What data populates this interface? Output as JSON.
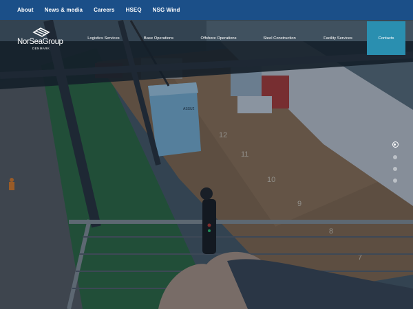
{
  "topbar": {
    "links": [
      {
        "label": "About"
      },
      {
        "label": "News & media"
      },
      {
        "label": "Careers"
      },
      {
        "label": "HSEQ"
      },
      {
        "label": "NSG Wind"
      }
    ]
  },
  "logo": {
    "name": "NorSeaGroup",
    "sub": "DENMARK"
  },
  "nav": {
    "items": [
      {
        "label": "Logistics Services"
      },
      {
        "label": "Base Operations"
      },
      {
        "label": "Offshore Operations"
      },
      {
        "label": "Steel Construction"
      },
      {
        "label": "Facility Services"
      },
      {
        "label": "Contacts",
        "active": true
      }
    ]
  },
  "slider": {
    "slides": 4,
    "active": 1
  },
  "hero": {
    "deck_markings": [
      "12",
      "11",
      "10",
      "9",
      "8",
      "7"
    ],
    "container_code": "ASSU2"
  },
  "colors": {
    "topbar": "#1b4f88",
    "active_nav": "#2a8fb0",
    "hull_green": "#2e6b3c",
    "deck": "#8a6a4a"
  }
}
